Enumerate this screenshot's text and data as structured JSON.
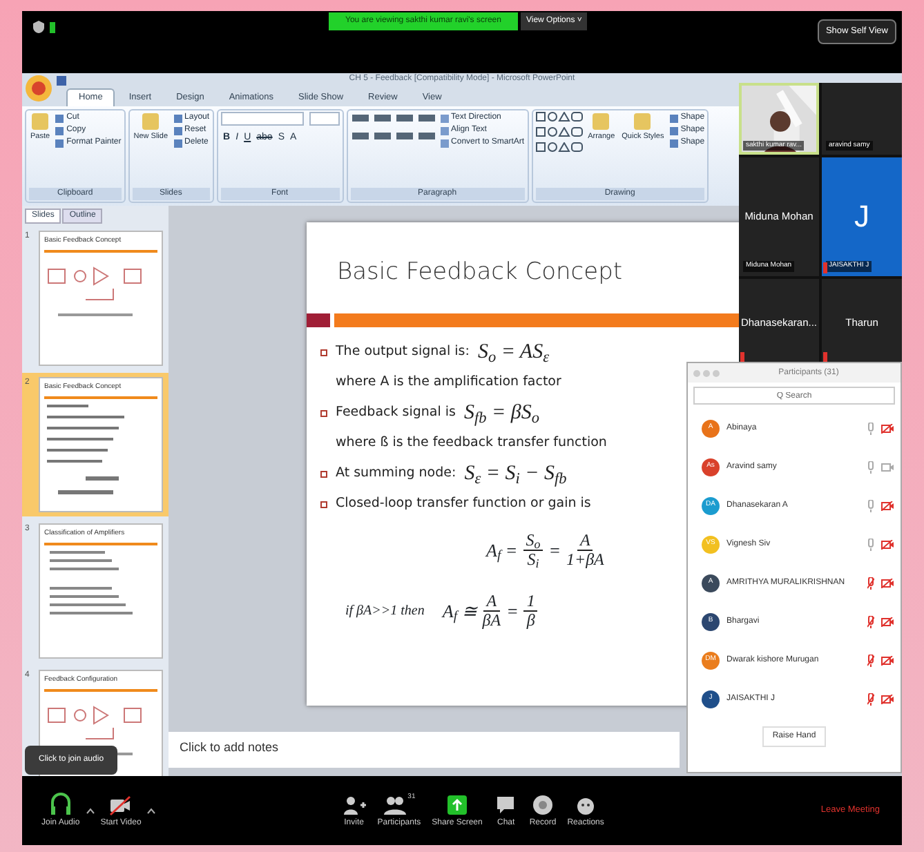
{
  "meeting_bar": {
    "banner": "You are viewing sakthi kumar ravi's screen",
    "view_options": "View Options ˅",
    "self_view": "Show Self View"
  },
  "window": {
    "title": "CH 5 - Feedback [Compatibility Mode] - Microsoft PowerPoint"
  },
  "ribbon_tabs": [
    {
      "label": "Home",
      "selected": true
    },
    {
      "label": "Insert",
      "selected": false
    },
    {
      "label": "Design",
      "selected": false
    },
    {
      "label": "Animations",
      "selected": false
    },
    {
      "label": "Slide Show",
      "selected": false
    },
    {
      "label": "Review",
      "selected": false
    },
    {
      "label": "View",
      "selected": false
    }
  ],
  "ribbon_groups": [
    {
      "label": "Clipboard",
      "kind": "buttons",
      "large": [
        "Paste"
      ],
      "small": [
        "Cut",
        "Copy",
        "Format Painter"
      ]
    },
    {
      "label": "Slides",
      "kind": "buttons",
      "large": [
        "New Slide"
      ],
      "small": [
        "Layout",
        "Reset",
        "Delete"
      ]
    },
    {
      "label": "Font",
      "kind": "font",
      "tools": [
        "B",
        "I",
        "U",
        "abe",
        "S",
        "A"
      ]
    },
    {
      "label": "Paragraph",
      "kind": "paragraph",
      "small": [
        "Text Direction",
        "Align Text",
        "Convert to SmartArt"
      ]
    },
    {
      "label": "Drawing",
      "kind": "drawing",
      "large": [
        "Arrange",
        "Quick Styles"
      ],
      "small": [
        "Shape",
        "Shape",
        "Shape"
      ]
    }
  ],
  "pane_tabs": [
    {
      "label": "Slides",
      "selected": true
    },
    {
      "label": "Outline",
      "selected": false
    }
  ],
  "thumbnails": [
    {
      "number": "1",
      "title": "Basic Feedback Concept",
      "kind": "diagram",
      "selected": false
    },
    {
      "number": "2",
      "title": "Basic Feedback Concept",
      "kind": "equations",
      "selected": true
    },
    {
      "number": "3",
      "title": "Classification of Amplifiers",
      "kind": "text",
      "selected": false
    },
    {
      "number": "4",
      "title": "Feedback Configuration",
      "kind": "diagram",
      "selected": false
    }
  ],
  "slide": {
    "title": "Basic Feedback Concept",
    "lines": [
      {
        "kind": "bullet",
        "text": "The output signal is:",
        "formula": "S$_{o}$ = AS$_{ε}$"
      },
      {
        "kind": "note",
        "text": "where A is the amplification factor"
      },
      {
        "kind": "bullet",
        "text": "Feedback signal is",
        "formula": "S$_{fb}$ = βS$_{o}$"
      },
      {
        "kind": "note",
        "text": "where ß is the feedback transfer function"
      },
      {
        "kind": "bullet",
        "text": "At summing node:",
        "formula": "S$_{ε}$ = S$_{i}$ − S$_{fb}$"
      },
      {
        "kind": "bullet",
        "text": "Closed-loop transfer function or gain is"
      },
      {
        "kind": "equation",
        "lhs": "A$_{f}$ =",
        "fractions": [
          {
            "num": "S$_{o}$",
            "den": "S$_{i}$"
          },
          {
            "op": "=",
            "num": "A",
            "den": "1+βA"
          }
        ]
      },
      {
        "kind": "equation",
        "text": "if βA>>1  then",
        "lhs": "A$_{f}$ ≅",
        "fractions": [
          {
            "num": "A",
            "den": "βA"
          },
          {
            "op": "=",
            "num": "1",
            "den": "β"
          }
        ]
      }
    ]
  },
  "notes_placeholder": "Click to add notes",
  "video_tiles": [
    {
      "kind": "camera",
      "name": "sakthi kumar rav...",
      "active": true,
      "muted": false
    },
    {
      "kind": "blank",
      "name": "aravind samy",
      "active": false,
      "muted": false
    },
    {
      "kind": "name",
      "display": "Miduna Mohan",
      "name": "Miduna Mohan",
      "active": false,
      "muted": false
    },
    {
      "kind": "avatar",
      "display": "J",
      "name": "JAISAKTHI J",
      "active": false,
      "muted": true
    },
    {
      "kind": "name",
      "display": "Dhanasekaran...",
      "active": false,
      "muted": true
    },
    {
      "kind": "name",
      "display": "Tharun",
      "active": false,
      "muted": true
    }
  ],
  "participants": {
    "title": "Participants (31)",
    "search_placeholder": "Q Search",
    "raise_hand": "Raise Hand",
    "people": [
      {
        "name": "Abinaya",
        "initials": "A",
        "color": "#e8731a",
        "mic_muted": false,
        "video_off": true
      },
      {
        "name": "Aravind samy",
        "initials": "As",
        "color": "#d9412b",
        "mic_muted": false,
        "video_off": false
      },
      {
        "name": "Dhanasekaran A",
        "initials": "DA",
        "color": "#1b9ccf",
        "mic_muted": false,
        "video_off": true
      },
      {
        "name": "Vignesh Siv",
        "initials": "VS",
        "color": "#f2c020",
        "mic_muted": false,
        "video_off": true
      },
      {
        "name": "AMRITHYA MURALIKRISHNAN",
        "initials": "A",
        "color": "#3b4a5c",
        "mic_muted": true,
        "video_off": true
      },
      {
        "name": "Bhargavi",
        "initials": "B",
        "color": "#2c4770",
        "mic_muted": true,
        "video_off": true
      },
      {
        "name": "Dwarak kishore Murugan",
        "initials": "DM",
        "color": "#ea7d1d",
        "mic_muted": true,
        "video_off": true
      },
      {
        "name": "JAISAKTHI J",
        "initials": "J",
        "color": "#1f4f8a",
        "mic_muted": true,
        "video_off": true
      }
    ]
  },
  "tooltip": "Click to join audio",
  "toolbar": [
    {
      "kind": "audio",
      "label": "Join Audio",
      "caret": true
    },
    {
      "kind": "video",
      "label": "Start Video",
      "caret": true
    },
    {
      "kind": "invite",
      "label": "Invite",
      "caret": false
    },
    {
      "kind": "participants",
      "label": "Participants",
      "count": "31",
      "caret": false
    },
    {
      "kind": "share",
      "label": "Share Screen",
      "caret": false
    },
    {
      "kind": "chat",
      "label": "Chat",
      "caret": false
    },
    {
      "kind": "record",
      "label": "Record",
      "caret": false
    },
    {
      "kind": "reactions",
      "label": "Reactions",
      "caret": false
    }
  ],
  "leave": "Leave Meeting"
}
